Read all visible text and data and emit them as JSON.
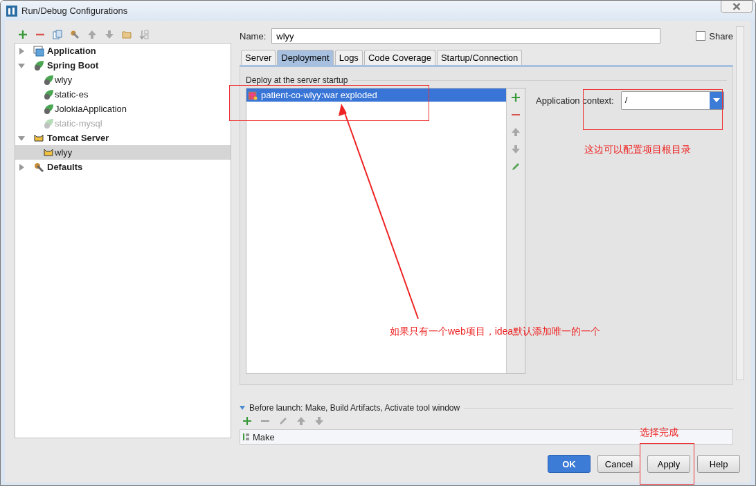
{
  "window": {
    "title": "Run/Debug Configurations"
  },
  "tree": [
    {
      "label": "Application",
      "kind": "application",
      "expanded": false
    },
    {
      "label": "Spring Boot",
      "kind": "spring",
      "expanded": true,
      "children": [
        {
          "label": "wlyy",
          "disabled": false,
          "selected": false
        },
        {
          "label": "static-es",
          "disabled": false,
          "selected": false
        },
        {
          "label": "JolokiaApplication",
          "disabled": false,
          "selected": false
        },
        {
          "label": "static-mysql",
          "disabled": true,
          "selected": false
        }
      ]
    },
    {
      "label": "Tomcat Server",
      "kind": "tomcat",
      "expanded": true,
      "children": [
        {
          "label": "wlyy",
          "disabled": false,
          "selected": true
        }
      ]
    },
    {
      "label": "Defaults",
      "kind": "defaults",
      "expanded": false
    }
  ],
  "name": {
    "label": "Name:",
    "value": "wlyy"
  },
  "share": {
    "label": "Share",
    "checked": false
  },
  "tabs": [
    {
      "label": "Server",
      "selected": false
    },
    {
      "label": "Deployment",
      "selected": true
    },
    {
      "label": "Logs",
      "selected": false
    },
    {
      "label": "Code Coverage",
      "selected": false
    },
    {
      "label": "Startup/Connection",
      "selected": false
    }
  ],
  "deployment": {
    "group_label": "Deploy at the server startup",
    "artifacts": [
      {
        "label": "patient-co-wlyy:war exploded",
        "selected": true
      }
    ],
    "context_label": "Application context:",
    "context_value": "/"
  },
  "before_launch": {
    "label": "Before launch: Make, Build Artifacts, Activate tool window",
    "expanded": true,
    "tasks": [
      {
        "label": "Make"
      }
    ]
  },
  "buttons": [
    {
      "label": "OK",
      "kind": "primary"
    },
    {
      "label": "Cancel",
      "kind": "normal"
    },
    {
      "label": "Apply",
      "kind": "normal"
    },
    {
      "label": "Help",
      "kind": "normal"
    }
  ],
  "annotations": {
    "notes": [
      "这边可以配置项目根目录",
      "如果只有一个web项目，idea默认添加唯一的一个",
      "选择完成"
    ]
  }
}
